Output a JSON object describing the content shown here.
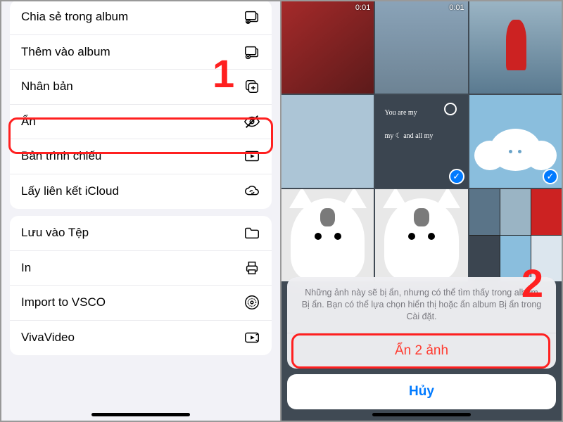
{
  "left_menu": {
    "group1": [
      {
        "label": "Chia sẻ trong album",
        "icon": "album-share-icon"
      },
      {
        "label": "Thêm vào album",
        "icon": "album-add-icon"
      },
      {
        "label": "Nhân bản",
        "icon": "duplicate-icon"
      },
      {
        "label": "Ẩn",
        "icon": "hide-icon"
      },
      {
        "label": "Bản trình chiếu",
        "icon": "slideshow-icon"
      },
      {
        "label": "Lấy liên kết iCloud",
        "icon": "icloud-link-icon"
      }
    ],
    "group2": [
      {
        "label": "Lưu vào Tệp",
        "icon": "folder-icon"
      },
      {
        "label": "In",
        "icon": "print-icon"
      },
      {
        "label": "Import to VSCO",
        "icon": "vsco-icon"
      },
      {
        "label": "VivaVideo",
        "icon": "vivavideo-icon"
      }
    ]
  },
  "steps": {
    "one": "1",
    "two": "2"
  },
  "right": {
    "video_durations": {
      "a": "0:01",
      "b": "0:01"
    },
    "handwriting_line1": "You are my",
    "handwriting_line2": "my ☾ and all my",
    "sheet_message": "Những ảnh này sẽ bị ẩn, nhưng có thể tìm thấy trong album Bị ẩn. Bạn có thể lựa chọn hiển thị hoặc ẩn album Bị ẩn trong Cài đặt.",
    "hide_button": "Ẩn 2 ảnh",
    "cancel_button": "Hủy"
  }
}
